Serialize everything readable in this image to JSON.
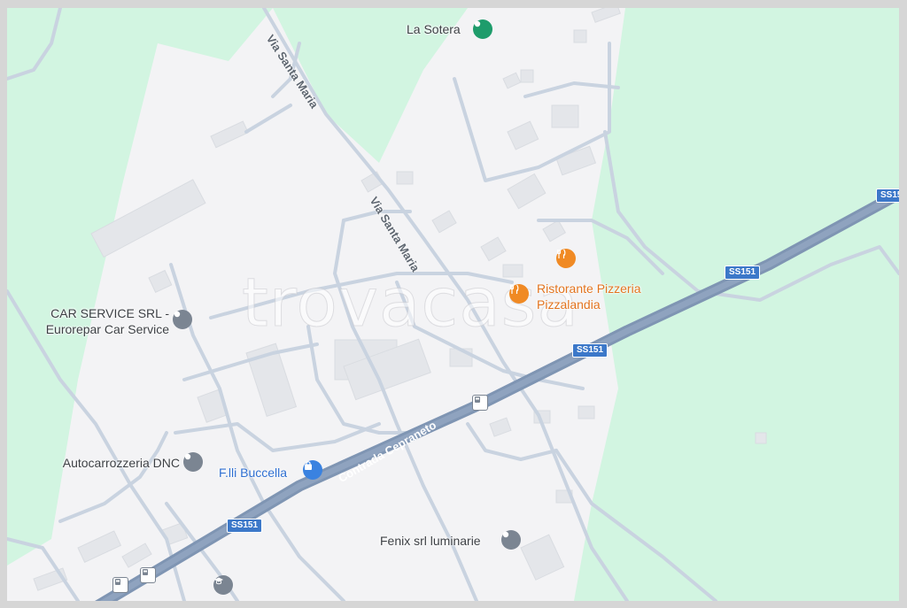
{
  "watermark": "trovacasa",
  "streets": {
    "via_santa_maria_1": "Via Santa Maria",
    "via_santa_maria_2": "Via Santa Maria",
    "contrada_cepraneto": "Contrada Cepraneto"
  },
  "route_shields": [
    "SS151",
    "SS151",
    "SS151",
    "SS15"
  ],
  "places": {
    "la_sotera": "La Sotera",
    "ristorante_line1": "Ristorante Pizzeria",
    "ristorante_line2": "Pizzalandia",
    "car_service_line1": "CAR SERVICE SRL -",
    "car_service_line2": "Eurorepar Car Service",
    "autocarrozzeria": "Autocarrozzeria DNC",
    "buccella": "F.lli Buccella",
    "fenix": "Fenix srl luminarie"
  },
  "colors": {
    "land": "#f3f3f5",
    "green": "#d2f5e1",
    "road": "#c9d3e0",
    "highway": "#7f95b3",
    "building": "#e4e6ea",
    "orange_poi": "#f08a24",
    "green_poi": "#1e9c6b",
    "gray_poi": "#7b8592",
    "blue_poi": "#3a82e0"
  }
}
